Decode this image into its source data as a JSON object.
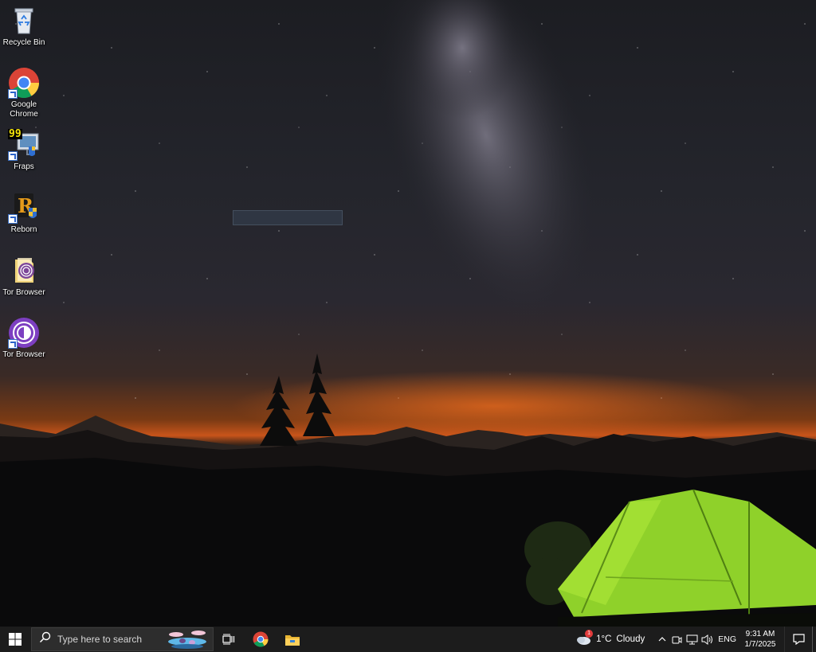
{
  "desktop": {
    "icons": [
      {
        "label": "Recycle Bin",
        "icon": "recycle-bin-icon"
      },
      {
        "label": "Google Chrome",
        "icon": "chrome-icon"
      },
      {
        "label": "Fraps",
        "icon": "fraps-icon"
      },
      {
        "label": "Reborn",
        "icon": "reborn-icon"
      },
      {
        "label": "Tor Browser",
        "icon": "tor-folder-icon"
      },
      {
        "label": "Tor Browser",
        "icon": "tor-browser-icon"
      }
    ],
    "fraps_counter": "99"
  },
  "taskbar": {
    "search_placeholder": "Type here to search",
    "weather": {
      "temp": "1°C",
      "condition": "Cloudy",
      "alert_count": "1"
    },
    "language": "ENG",
    "time": "9:31 AM",
    "date": "1/7/2025",
    "pinned": [
      "task-view-icon",
      "chrome-icon",
      "file-explorer-icon"
    ]
  },
  "colors": {
    "taskbar": "#1c1c1c",
    "search_bg": "#2d2d2d",
    "tent_green": "#8fd12a",
    "horizon_orange": "#c8541a"
  }
}
